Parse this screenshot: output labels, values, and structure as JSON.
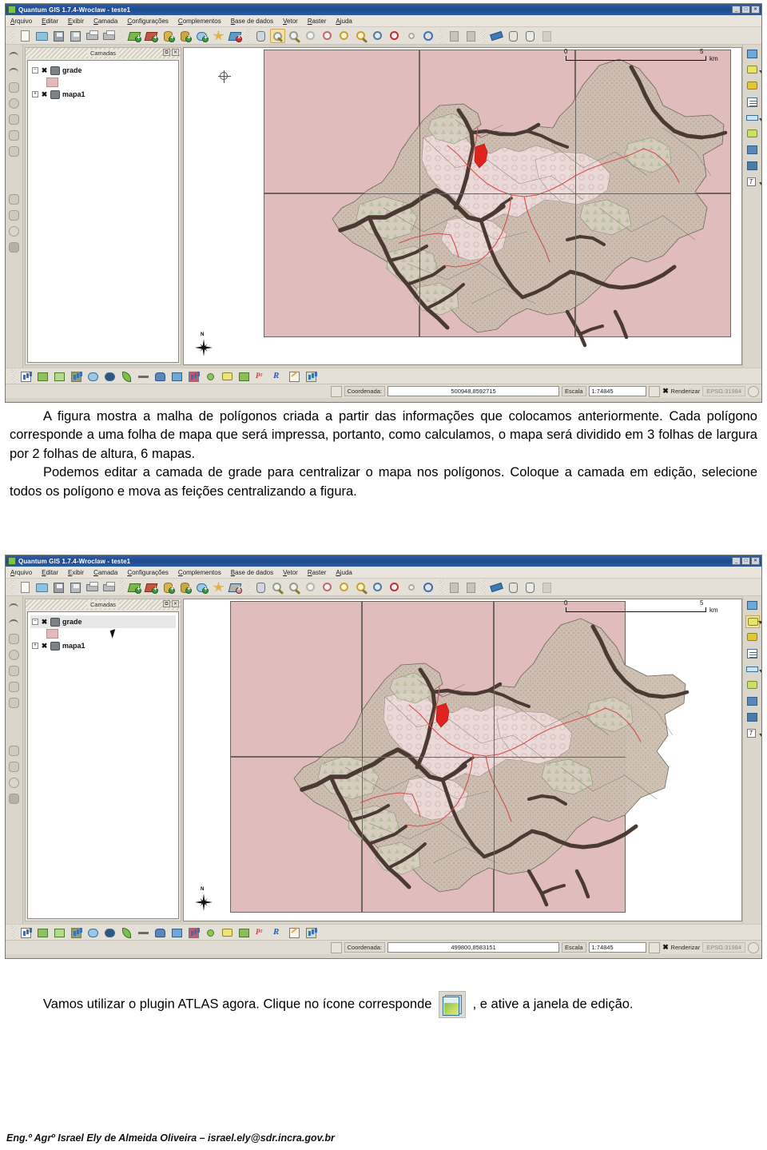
{
  "document": {
    "paragraphs": [
      "A figura mostra a malha de polígonos criada a partir das informações que colocamos anteriormente. Cada polígono corresponde a uma folha de mapa que será impressa, portanto, como calculamos, o mapa será dividido em 3 folhas de largura por 2 folhas de altura, 6 mapas.",
      "Podemos editar a camada de grade para centralizar o mapa nos polígonos. Coloque a camada em edição, selecione todos os polígono e mova as feições centralizando a figura."
    ],
    "closing_part1": "Vamos utilizar o plugin ATLAS agora. Clique no ícone corresponde",
    "closing_part2": ", e ative a janela de edição.",
    "footer": "Eng.º Agrº Israel Ely de Almeida Oliveira – israel.ely@sdr.incra.gov.br",
    "atlas_icon_name": "atlas-plugin-icon"
  },
  "app": {
    "title": "Quantum GIS 1.7.4-Wroclaw - teste1",
    "window_buttons": [
      "_",
      "□",
      "✕"
    ],
    "menu": [
      "Arquivo",
      "Editar",
      "Exibir",
      "Camada",
      "Configurações",
      "Complementos",
      "Base de dados",
      "Vetor",
      "Raster",
      "Ajuda"
    ],
    "toolbar_icons": [
      {
        "name": "new-project-icon",
        "type": "doc"
      },
      {
        "name": "open-project-icon",
        "type": "folder"
      },
      {
        "name": "save-project-icon",
        "type": "save"
      },
      {
        "name": "save-project-as-icon",
        "type": "saveas"
      },
      {
        "name": "new-print-composer-icon",
        "type": "printcomp"
      },
      {
        "name": "composer-manager-icon",
        "type": "print"
      },
      {
        "name": "add-vector-layer-icon",
        "type": "layer-g"
      },
      {
        "name": "add-raster-layer-icon",
        "type": "layer-r"
      },
      {
        "name": "add-postgis-layer-icon",
        "type": "db"
      },
      {
        "name": "add-spatialite-layer-icon",
        "type": "db2"
      },
      {
        "name": "add-wms-layer-icon",
        "type": "wms"
      },
      {
        "name": "new-shapefile-layer-icon",
        "type": "star"
      },
      {
        "name": "remove-layer-icon",
        "type": "layer-x"
      },
      {
        "name": "pan-map-icon",
        "type": "hand"
      },
      {
        "name": "zoom-in-icon",
        "type": "zoom-in",
        "selected": true
      },
      {
        "name": "zoom-out-icon",
        "type": "zoom-out"
      },
      {
        "name": "zoom-full-icon",
        "type": "zoom-full"
      },
      {
        "name": "zoom-to-selection-icon",
        "type": "zoom-sel"
      },
      {
        "name": "zoom-to-layer-icon",
        "type": "zoom-layer"
      },
      {
        "name": "zoom-last-icon",
        "type": "zoom-last"
      },
      {
        "name": "zoom-next-icon",
        "type": "zoom-next"
      },
      {
        "name": "zoom-actual-size-icon",
        "type": "zoom-actual"
      },
      {
        "name": "refresh-icon",
        "type": "refresh"
      },
      {
        "name": "attribute-table-icon",
        "type": "gray"
      },
      {
        "name": "statistics-icon",
        "type": "gray2"
      },
      {
        "name": "measure-line-icon",
        "type": "ruler"
      },
      {
        "name": "identify-features-icon",
        "type": "ident"
      },
      {
        "name": "select-features-icon",
        "type": "select"
      },
      {
        "name": "deselect-icon",
        "type": "deselect"
      }
    ],
    "plugin_toolbar_icons": [
      {
        "name": "plugin-chart-icon",
        "type": "chart"
      },
      {
        "name": "plugin-green-arrow-icon",
        "type": "green"
      },
      {
        "name": "plugin-export-icon",
        "type": "export"
      },
      {
        "name": "plugin-photo-icon",
        "type": "photo"
      },
      {
        "name": "plugin-globe-icon",
        "type": "globe"
      },
      {
        "name": "plugin-compass-icon",
        "type": "compass"
      },
      {
        "name": "plugin-leaf-icon",
        "type": "leaf"
      },
      {
        "name": "plugin-dash-icon",
        "type": "dash"
      },
      {
        "name": "plugin-postgres-icon",
        "type": "elephant"
      },
      {
        "name": "plugin-raster-icon",
        "type": "blue"
      },
      {
        "name": "plugin-mosaic-icon",
        "type": "mosaic"
      },
      {
        "name": "plugin-dot-icon",
        "type": "dot"
      },
      {
        "name": "plugin-fields-icon",
        "type": "fields"
      },
      {
        "name": "plugin-tools-icon",
        "type": "tools"
      },
      {
        "name": "plugin-p2-icon",
        "type": "p2"
      },
      {
        "name": "plugin-r-icon",
        "type": "rlogo"
      },
      {
        "name": "plugin-edit-icon",
        "type": "pencil"
      },
      {
        "name": "plugin-table-icon",
        "type": "table"
      }
    ],
    "right_toolbar_icons": [
      {
        "name": "add-map-icon",
        "type": "addmap"
      },
      {
        "name": "select-item-icon",
        "type": "selectitem",
        "caret": true
      },
      {
        "name": "move-item-icon",
        "type": "moveitem"
      },
      {
        "name": "add-legend-icon",
        "type": "list"
      },
      {
        "name": "add-scalebar-icon",
        "type": "scalebar",
        "caret": true
      },
      {
        "name": "add-label-icon",
        "type": "label"
      },
      {
        "name": "add-image-icon",
        "type": "image1"
      },
      {
        "name": "add-image2-icon",
        "type": "image2"
      },
      {
        "name": "add-text-icon",
        "type": "textT",
        "caret": true
      }
    ],
    "left_toolbar_icons": [
      {
        "name": "undo-icon"
      },
      {
        "name": "redo-icon"
      },
      {
        "name": "edit-tool-icon"
      },
      {
        "name": "add-feature-icon"
      },
      {
        "name": "move-feature-icon"
      },
      {
        "name": "node-tool-icon"
      },
      {
        "name": "delete-selected-icon"
      },
      {
        "name": "split-features-icon"
      },
      {
        "name": "merge-features-icon"
      },
      {
        "name": "reshape-features-icon"
      },
      {
        "name": "simplify-feature-icon"
      },
      {
        "name": "rotate-icon"
      },
      {
        "name": "fill-ring-icon"
      }
    ],
    "panel": {
      "title": "Camadas",
      "buttons": [
        "⧉",
        "✕"
      ],
      "layers": [
        {
          "name": "grade",
          "checked": "✖",
          "expander": "−",
          "has_swatch": true,
          "swatch_color": "#e3b9b9"
        },
        {
          "name": "mapa1",
          "checked": "✖",
          "expander": "+",
          "has_swatch": false
        }
      ]
    },
    "map": {
      "scalebar": {
        "min": "0",
        "max": "5",
        "unit": "km"
      },
      "north_label": "N"
    },
    "statusbar": {
      "coordinate_label": "Coordenada:",
      "scale_label": "Escala",
      "render_label": "Renderizar",
      "render_checked": "✖",
      "crs": "EPSG:31984"
    }
  },
  "screenshot1": {
    "coordinate_value": "500948,8592715",
    "scale_value": "1:74845",
    "selected_layer": null
  },
  "screenshot2": {
    "coordinate_value": "499800,8583151",
    "scale_value": "1:74845",
    "selected_layer": "grade"
  }
}
